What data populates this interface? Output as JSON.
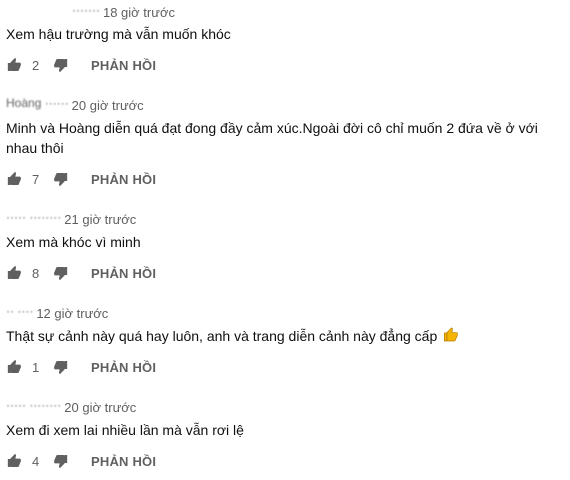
{
  "comments": [
    {
      "author": "·······",
      "time": "18 giờ trước",
      "text": "Xem hậu trường mà vẫn muốn khóc",
      "likes": "2",
      "reply_label": "PHẢN HỒI"
    },
    {
      "author": "Hoàng ······",
      "time": "20 giờ trước",
      "text": "Minh và Hoàng diễn quá đạt đong đầy cảm xúc.Ngoài đời cô chỉ muốn 2 đứa về ở với nhau thôi",
      "likes": "7",
      "reply_label": "PHẢN HỒI"
    },
    {
      "author": "····· ········",
      "time": "21 giờ trước",
      "text": "Xem mà khóc vì minh",
      "likes": "8",
      "reply_label": "PHẢN HỒI"
    },
    {
      "author": "·· ····",
      "time": "12 giờ trước",
      "text": "Thật sự cảnh này quá hay luôn, anh và trang diễn cảnh này đẳng cấp",
      "emoji": "thumbs-up-emoji",
      "likes": "1",
      "reply_label": "PHẢN HỒI"
    },
    {
      "author": "····· ········",
      "time": "20 giờ trước",
      "text": "Xem đi xem lai nhiều lần mà vẫn rơi lệ",
      "likes": "4",
      "reply_label": "PHẢN HỒI"
    }
  ],
  "icons": {
    "like": "thumb-up-icon",
    "dislike": "thumb-down-icon"
  },
  "colors": {
    "text": "#0f0f0f",
    "secondary": "#606060",
    "emoji": "#f5b400"
  }
}
